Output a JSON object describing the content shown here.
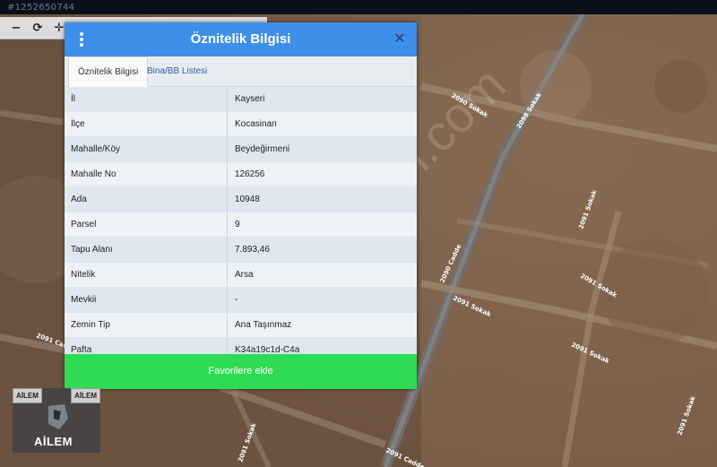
{
  "listing_id": "#1252650744",
  "toolbar": {
    "zoom_out_icon": "minus-icon",
    "refresh_icon": "refresh-icon",
    "pan_icon": "move-icon",
    "zoom_out_glyph": "−",
    "refresh_glyph": "⟳",
    "pan_glyph": "✛"
  },
  "dialog": {
    "title": "Öznitelik Bilgisi",
    "menu_icon": "vertical-dots-icon",
    "close_icon": "close-icon",
    "close_glyph": "✕",
    "accent_color": "#3d8fe9",
    "tabs": [
      {
        "label": "Öznitelik Bilgisi",
        "active": true
      },
      {
        "label": "Bina/BB Listesi",
        "active": false
      }
    ],
    "rows": [
      {
        "label": "İl",
        "value": "Kayseri"
      },
      {
        "label": "İlçe",
        "value": "Kocasinan"
      },
      {
        "label": "Mahalle/Köy",
        "value": "Beydeğirmeni"
      },
      {
        "label": "Mahalle No",
        "value": "126256"
      },
      {
        "label": "Ada",
        "value": "10948"
      },
      {
        "label": "Parsel",
        "value": "9"
      },
      {
        "label": "Tapu Alanı",
        "value": "7.893,46"
      },
      {
        "label": "Nitelik",
        "value": "Arsa"
      },
      {
        "label": "Mevkii",
        "value": "-"
      },
      {
        "label": "Zemin Tip",
        "value": "Ana Taşınmaz"
      },
      {
        "label": "Pafta",
        "value": "K34a19c1d-C4a"
      }
    ],
    "favorite_button": "Favorilere ekle",
    "favorite_color": "#2fdb53"
  },
  "map": {
    "watermark": "sahibinden.com",
    "street_labels": [
      "2090 Sokak",
      "2098 Sokak",
      "2091 Sokak",
      "2091 Sokak",
      "2090 Cadde",
      "2091 Sokak",
      "2091 Sokak",
      "2091 Cadde",
      "2091 Sokak",
      "2091 Sokak",
      "2091 Cadde"
    ]
  },
  "logo": {
    "badge_left": "AİLEM",
    "badge_right": "AİLEM",
    "name": "AİLEM"
  }
}
